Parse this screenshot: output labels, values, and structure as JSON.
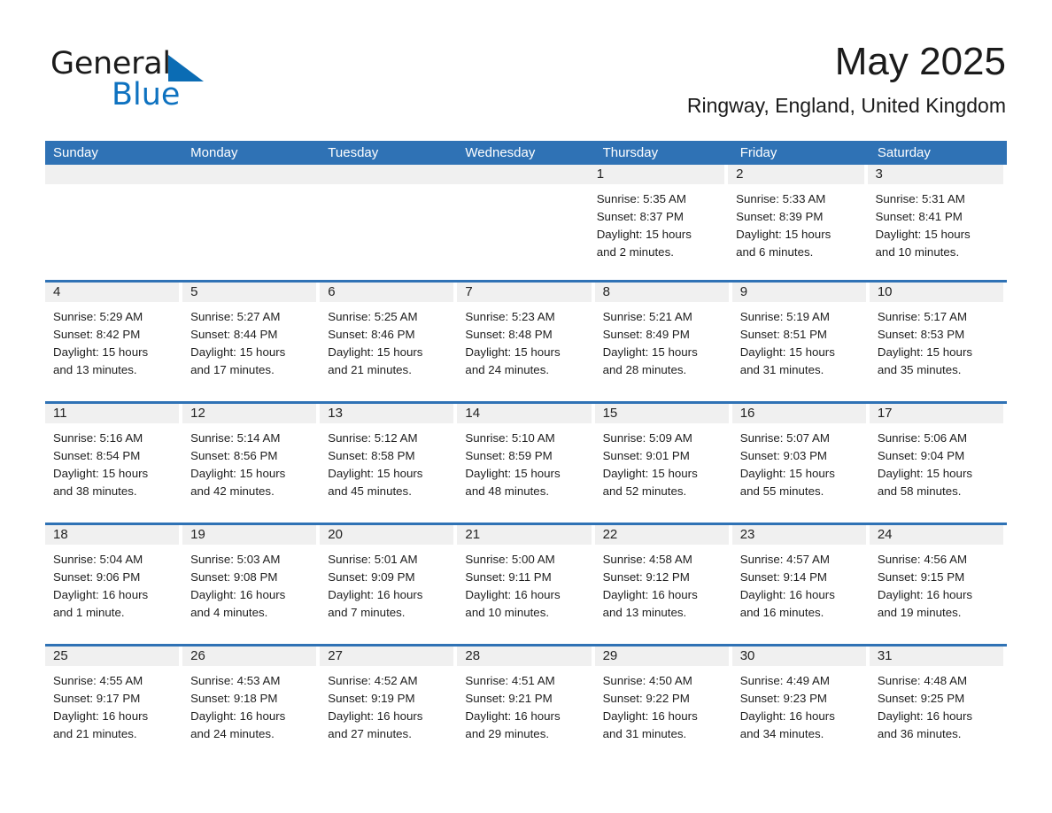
{
  "brand": {
    "name_part1": "General",
    "name_part2": "Blue",
    "triangle_color": "#0b6cb4",
    "blue_text_color": "#0e72c0"
  },
  "header": {
    "title": "May 2025",
    "subtitle": "Ringway, England, United Kingdom"
  },
  "theme": {
    "header_blue": "#2f72b5",
    "date_band_gray": "#f0f0f0",
    "text_dark": "#1e1e1e"
  },
  "weekdays": [
    "Sunday",
    "Monday",
    "Tuesday",
    "Wednesday",
    "Thursday",
    "Friday",
    "Saturday"
  ],
  "weeks": [
    {
      "days": [
        {
          "date": "",
          "empty": true,
          "sunrise": "",
          "sunset": "",
          "daylight_line1": "",
          "daylight_line2": ""
        },
        {
          "date": "",
          "empty": true,
          "sunrise": "",
          "sunset": "",
          "daylight_line1": "",
          "daylight_line2": ""
        },
        {
          "date": "",
          "empty": true,
          "sunrise": "",
          "sunset": "",
          "daylight_line1": "",
          "daylight_line2": ""
        },
        {
          "date": "",
          "empty": true,
          "sunrise": "",
          "sunset": "",
          "daylight_line1": "",
          "daylight_line2": ""
        },
        {
          "date": "1",
          "empty": false,
          "sunrise": "Sunrise: 5:35 AM",
          "sunset": "Sunset: 8:37 PM",
          "daylight_line1": "Daylight: 15 hours",
          "daylight_line2": "and 2 minutes."
        },
        {
          "date": "2",
          "empty": false,
          "sunrise": "Sunrise: 5:33 AM",
          "sunset": "Sunset: 8:39 PM",
          "daylight_line1": "Daylight: 15 hours",
          "daylight_line2": "and 6 minutes."
        },
        {
          "date": "3",
          "empty": false,
          "sunrise": "Sunrise: 5:31 AM",
          "sunset": "Sunset: 8:41 PM",
          "daylight_line1": "Daylight: 15 hours",
          "daylight_line2": "and 10 minutes."
        }
      ]
    },
    {
      "days": [
        {
          "date": "4",
          "empty": false,
          "sunrise": "Sunrise: 5:29 AM",
          "sunset": "Sunset: 8:42 PM",
          "daylight_line1": "Daylight: 15 hours",
          "daylight_line2": "and 13 minutes."
        },
        {
          "date": "5",
          "empty": false,
          "sunrise": "Sunrise: 5:27 AM",
          "sunset": "Sunset: 8:44 PM",
          "daylight_line1": "Daylight: 15 hours",
          "daylight_line2": "and 17 minutes."
        },
        {
          "date": "6",
          "empty": false,
          "sunrise": "Sunrise: 5:25 AM",
          "sunset": "Sunset: 8:46 PM",
          "daylight_line1": "Daylight: 15 hours",
          "daylight_line2": "and 21 minutes."
        },
        {
          "date": "7",
          "empty": false,
          "sunrise": "Sunrise: 5:23 AM",
          "sunset": "Sunset: 8:48 PM",
          "daylight_line1": "Daylight: 15 hours",
          "daylight_line2": "and 24 minutes."
        },
        {
          "date": "8",
          "empty": false,
          "sunrise": "Sunrise: 5:21 AM",
          "sunset": "Sunset: 8:49 PM",
          "daylight_line1": "Daylight: 15 hours",
          "daylight_line2": "and 28 minutes."
        },
        {
          "date": "9",
          "empty": false,
          "sunrise": "Sunrise: 5:19 AM",
          "sunset": "Sunset: 8:51 PM",
          "daylight_line1": "Daylight: 15 hours",
          "daylight_line2": "and 31 minutes."
        },
        {
          "date": "10",
          "empty": false,
          "sunrise": "Sunrise: 5:17 AM",
          "sunset": "Sunset: 8:53 PM",
          "daylight_line1": "Daylight: 15 hours",
          "daylight_line2": "and 35 minutes."
        }
      ]
    },
    {
      "days": [
        {
          "date": "11",
          "empty": false,
          "sunrise": "Sunrise: 5:16 AM",
          "sunset": "Sunset: 8:54 PM",
          "daylight_line1": "Daylight: 15 hours",
          "daylight_line2": "and 38 minutes."
        },
        {
          "date": "12",
          "empty": false,
          "sunrise": "Sunrise: 5:14 AM",
          "sunset": "Sunset: 8:56 PM",
          "daylight_line1": "Daylight: 15 hours",
          "daylight_line2": "and 42 minutes."
        },
        {
          "date": "13",
          "empty": false,
          "sunrise": "Sunrise: 5:12 AM",
          "sunset": "Sunset: 8:58 PM",
          "daylight_line1": "Daylight: 15 hours",
          "daylight_line2": "and 45 minutes."
        },
        {
          "date": "14",
          "empty": false,
          "sunrise": "Sunrise: 5:10 AM",
          "sunset": "Sunset: 8:59 PM",
          "daylight_line1": "Daylight: 15 hours",
          "daylight_line2": "and 48 minutes."
        },
        {
          "date": "15",
          "empty": false,
          "sunrise": "Sunrise: 5:09 AM",
          "sunset": "Sunset: 9:01 PM",
          "daylight_line1": "Daylight: 15 hours",
          "daylight_line2": "and 52 minutes."
        },
        {
          "date": "16",
          "empty": false,
          "sunrise": "Sunrise: 5:07 AM",
          "sunset": "Sunset: 9:03 PM",
          "daylight_line1": "Daylight: 15 hours",
          "daylight_line2": "and 55 minutes."
        },
        {
          "date": "17",
          "empty": false,
          "sunrise": "Sunrise: 5:06 AM",
          "sunset": "Sunset: 9:04 PM",
          "daylight_line1": "Daylight: 15 hours",
          "daylight_line2": "and 58 minutes."
        }
      ]
    },
    {
      "days": [
        {
          "date": "18",
          "empty": false,
          "sunrise": "Sunrise: 5:04 AM",
          "sunset": "Sunset: 9:06 PM",
          "daylight_line1": "Daylight: 16 hours",
          "daylight_line2": "and 1 minute."
        },
        {
          "date": "19",
          "empty": false,
          "sunrise": "Sunrise: 5:03 AM",
          "sunset": "Sunset: 9:08 PM",
          "daylight_line1": "Daylight: 16 hours",
          "daylight_line2": "and 4 minutes."
        },
        {
          "date": "20",
          "empty": false,
          "sunrise": "Sunrise: 5:01 AM",
          "sunset": "Sunset: 9:09 PM",
          "daylight_line1": "Daylight: 16 hours",
          "daylight_line2": "and 7 minutes."
        },
        {
          "date": "21",
          "empty": false,
          "sunrise": "Sunrise: 5:00 AM",
          "sunset": "Sunset: 9:11 PM",
          "daylight_line1": "Daylight: 16 hours",
          "daylight_line2": "and 10 minutes."
        },
        {
          "date": "22",
          "empty": false,
          "sunrise": "Sunrise: 4:58 AM",
          "sunset": "Sunset: 9:12 PM",
          "daylight_line1": "Daylight: 16 hours",
          "daylight_line2": "and 13 minutes."
        },
        {
          "date": "23",
          "empty": false,
          "sunrise": "Sunrise: 4:57 AM",
          "sunset": "Sunset: 9:14 PM",
          "daylight_line1": "Daylight: 16 hours",
          "daylight_line2": "and 16 minutes."
        },
        {
          "date": "24",
          "empty": false,
          "sunrise": "Sunrise: 4:56 AM",
          "sunset": "Sunset: 9:15 PM",
          "daylight_line1": "Daylight: 16 hours",
          "daylight_line2": "and 19 minutes."
        }
      ]
    },
    {
      "days": [
        {
          "date": "25",
          "empty": false,
          "sunrise": "Sunrise: 4:55 AM",
          "sunset": "Sunset: 9:17 PM",
          "daylight_line1": "Daylight: 16 hours",
          "daylight_line2": "and 21 minutes."
        },
        {
          "date": "26",
          "empty": false,
          "sunrise": "Sunrise: 4:53 AM",
          "sunset": "Sunset: 9:18 PM",
          "daylight_line1": "Daylight: 16 hours",
          "daylight_line2": "and 24 minutes."
        },
        {
          "date": "27",
          "empty": false,
          "sunrise": "Sunrise: 4:52 AM",
          "sunset": "Sunset: 9:19 PM",
          "daylight_line1": "Daylight: 16 hours",
          "daylight_line2": "and 27 minutes."
        },
        {
          "date": "28",
          "empty": false,
          "sunrise": "Sunrise: 4:51 AM",
          "sunset": "Sunset: 9:21 PM",
          "daylight_line1": "Daylight: 16 hours",
          "daylight_line2": "and 29 minutes."
        },
        {
          "date": "29",
          "empty": false,
          "sunrise": "Sunrise: 4:50 AM",
          "sunset": "Sunset: 9:22 PM",
          "daylight_line1": "Daylight: 16 hours",
          "daylight_line2": "and 31 minutes."
        },
        {
          "date": "30",
          "empty": false,
          "sunrise": "Sunrise: 4:49 AM",
          "sunset": "Sunset: 9:23 PM",
          "daylight_line1": "Daylight: 16 hours",
          "daylight_line2": "and 34 minutes."
        },
        {
          "date": "31",
          "empty": false,
          "sunrise": "Sunrise: 4:48 AM",
          "sunset": "Sunset: 9:25 PM",
          "daylight_line1": "Daylight: 16 hours",
          "daylight_line2": "and 36 minutes."
        }
      ]
    }
  ]
}
